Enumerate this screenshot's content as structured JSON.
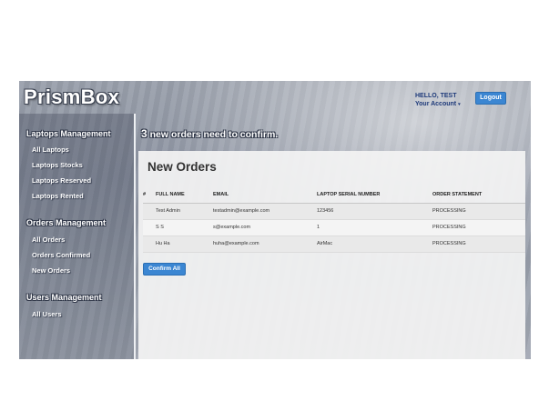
{
  "app": {
    "logo": "PrismBox"
  },
  "header": {
    "greeting": "HELLO, TEST",
    "account_label": "Your Account",
    "account_caret": "▾",
    "logout_label": "Logout"
  },
  "sidebar": {
    "sections": [
      {
        "heading": "Laptops Management",
        "items": [
          "All Laptops",
          "Laptops Stocks",
          "Laptops Reserved",
          "Laptops Rented"
        ]
      },
      {
        "heading": "Orders Management",
        "items": [
          "All Orders",
          "Orders Confirmed",
          "New Orders"
        ]
      },
      {
        "heading": "Users Management",
        "items": [
          "All Users"
        ]
      }
    ]
  },
  "main": {
    "notice_count": "3",
    "notice_text": "new orders need to confirm.",
    "panel_title": "New Orders",
    "table": {
      "headers": [
        "#",
        "FULL NAME",
        "EMAIL",
        "LAPTOP SERIAL NUMBER",
        "ORDER STATEMENT"
      ],
      "rows": [
        [
          "",
          "Test Admin",
          "testadmin@example.com",
          "123456",
          "PROCESSING"
        ],
        [
          "",
          "S S",
          "s@example.com",
          "1",
          "PROCESSING"
        ],
        [
          "",
          "Hu Ha",
          "huha@example.com",
          "AirMac",
          "PROCESSING"
        ]
      ]
    },
    "confirm_label": "Confirm All"
  }
}
